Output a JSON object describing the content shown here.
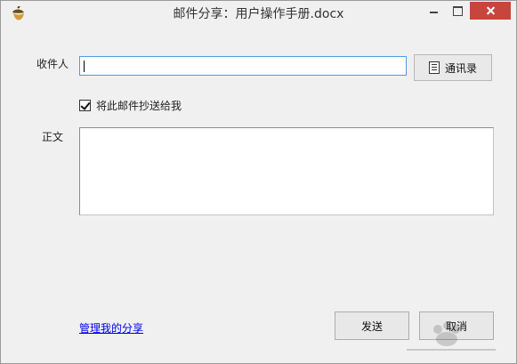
{
  "window": {
    "title": "邮件分享：用户操作手册.docx"
  },
  "form": {
    "recipient_label": "收件人",
    "recipient_value": "",
    "contacts_button_label": "通讯录",
    "cc_self_label": "将此邮件抄送给我",
    "cc_self_checked": true,
    "body_label": "正文",
    "body_value": ""
  },
  "footer": {
    "manage_shares_link": "管理我的分享",
    "send_button": "发送",
    "cancel_button": "取消"
  },
  "icons": {
    "app": "acorn-icon",
    "minimize": "minimize-icon",
    "maximize": "maximize-icon",
    "close": "close-icon",
    "contacts": "address-book-icon",
    "checkbox": "check-icon"
  },
  "colors": {
    "window_bg": "#f0f0f0",
    "close_button": "#c7463c",
    "link": "#0000ee",
    "focus_border": "#4f9be2"
  }
}
